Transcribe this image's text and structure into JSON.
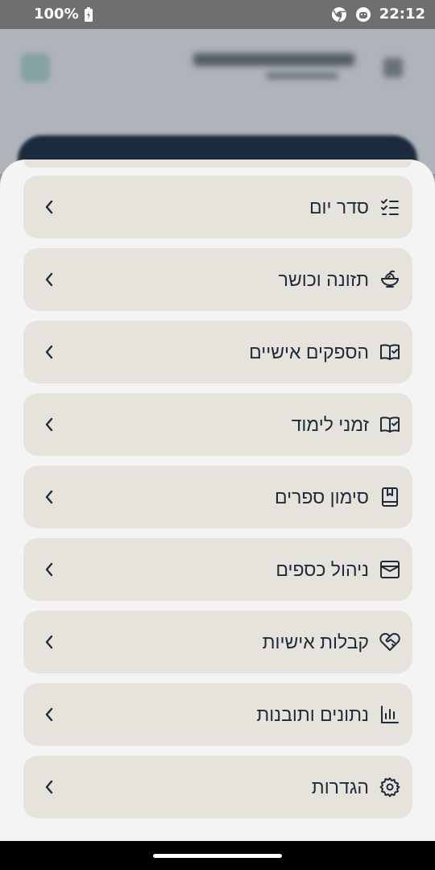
{
  "status_bar": {
    "battery": "100%",
    "time": "22:12"
  },
  "menu": {
    "items": [
      {
        "label": "סדר יום",
        "icon": "checklist-icon"
      },
      {
        "label": "תזונה וכושר",
        "icon": "salad-bowl-icon"
      },
      {
        "label": "הספקים אישיים",
        "icon": "book-check-icon"
      },
      {
        "label": "זמני לימוד",
        "icon": "book-check-icon"
      },
      {
        "label": "סימון ספרים",
        "icon": "bookmark-book-icon"
      },
      {
        "label": "ניהול כספים",
        "icon": "wallet-icon"
      },
      {
        "label": "קבלות אישיות",
        "icon": "heart-handshake-icon"
      },
      {
        "label": "נתונים ותובנות",
        "icon": "bar-chart-icon"
      },
      {
        "label": "הגדרות",
        "icon": "gear-icon"
      }
    ]
  },
  "colors": {
    "item_bg": "#e6e3dd",
    "sheet_bg": "#f4f4f4",
    "text": "#1f2b3a"
  }
}
